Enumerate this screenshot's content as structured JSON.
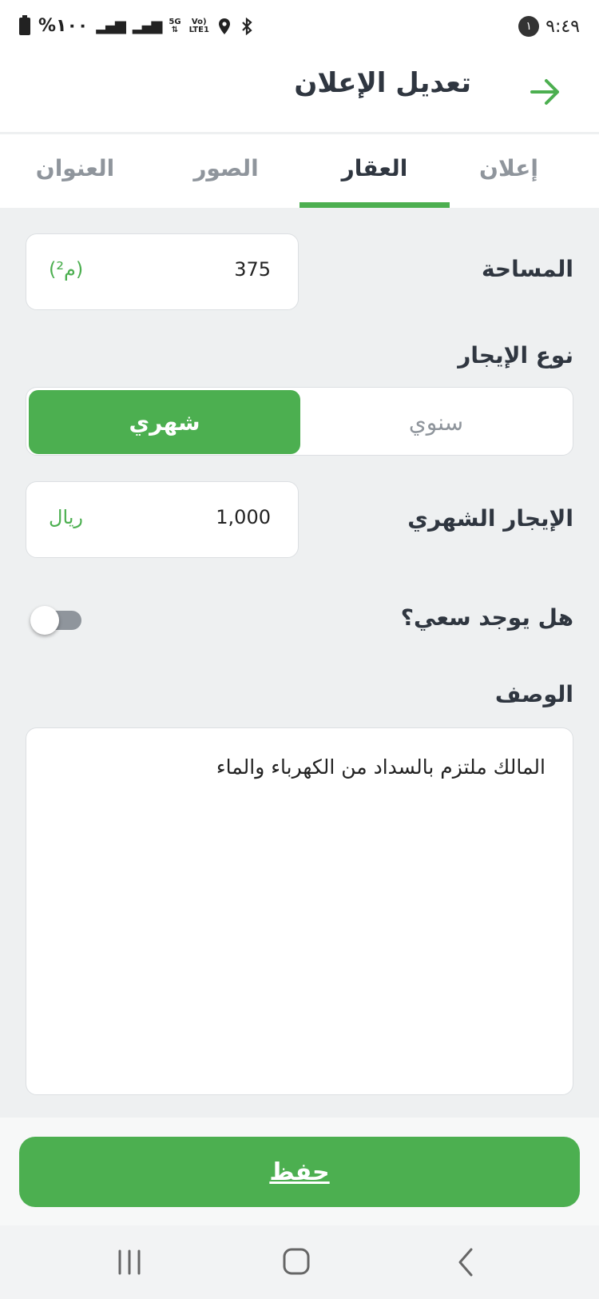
{
  "status_bar": {
    "time": "٩:٤٩",
    "notification_count": "١",
    "battery": "%١٠٠",
    "network": "5G",
    "network_secondary": "LTE1"
  },
  "header": {
    "title": "تعديل الإعلان"
  },
  "tabs": [
    {
      "label": "إعلان"
    },
    {
      "label": "العقار"
    },
    {
      "label": "الصور"
    },
    {
      "label": "العنوان"
    }
  ],
  "form": {
    "area": {
      "label": "المساحة",
      "value": "375",
      "unit": "(م²)"
    },
    "rent_type": {
      "label": "نوع الإيجار",
      "options": [
        "سنوي",
        "شهري"
      ],
      "selected": "شهري"
    },
    "monthly_rent": {
      "label": "الإيجار الشهري",
      "value": "1,000",
      "unit": "ريال"
    },
    "commission": {
      "label": "هل يوجد سعي؟",
      "enabled": false
    },
    "description": {
      "label": "الوصف",
      "value": "المالك ملتزم بالسداد من الكهرباء والماء"
    }
  },
  "actions": {
    "save_label": "حفظ"
  },
  "colors": {
    "accent": "#4caf50",
    "text_dark": "#2f3640",
    "text_muted": "#8f959c"
  }
}
